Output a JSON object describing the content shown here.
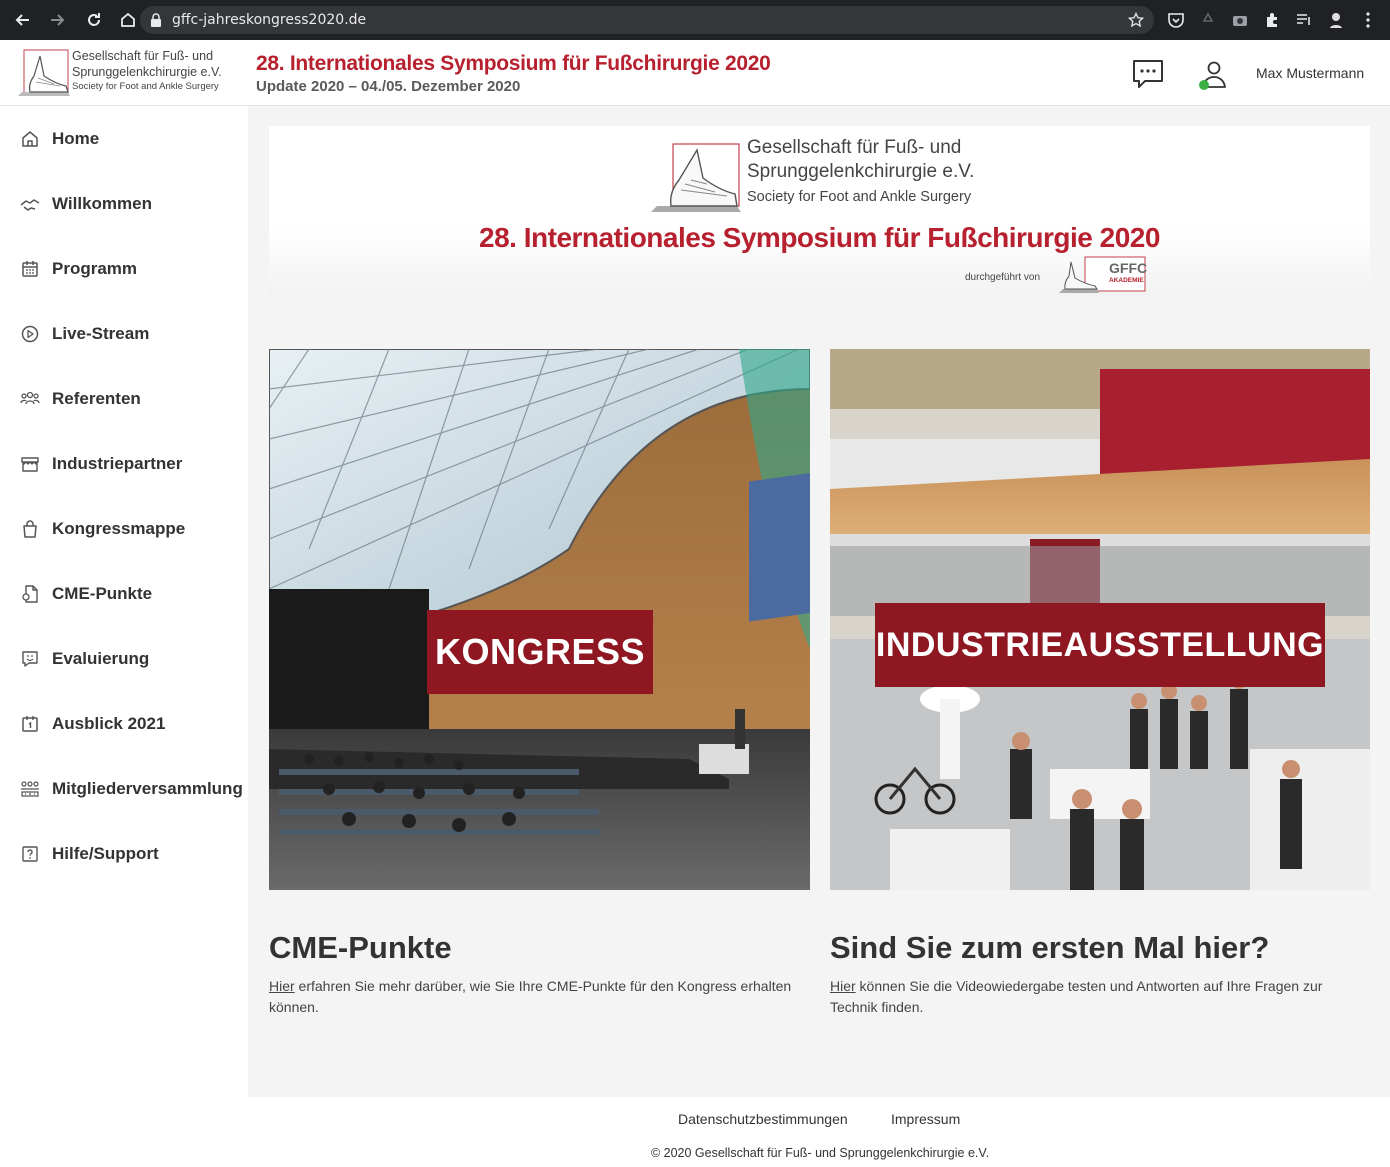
{
  "browser": {
    "url": "gffc-jahreskongress2020.de"
  },
  "header": {
    "logo_line1": "Gesellschaft für Fuß- und",
    "logo_line2": "Sprunggelenkchirurgie e.V.",
    "logo_line3": "Society for Foot and Ankle Surgery",
    "title": "28. Internationales Symposium für Fußchirurgie 2020",
    "subtitle": "Update 2020 – 04./05. Dezember 2020",
    "user_name": "Max Mustermann",
    "online_color": "#3cb043"
  },
  "sidebar": {
    "items": [
      {
        "label": "Home",
        "icon": "home-icon"
      },
      {
        "label": "Willkommen",
        "icon": "handshake-icon"
      },
      {
        "label": "Programm",
        "icon": "calendar-icon"
      },
      {
        "label": "Live-Stream",
        "icon": "play-icon"
      },
      {
        "label": "Referenten",
        "icon": "people-icon"
      },
      {
        "label": "Industriepartner",
        "icon": "store-icon"
      },
      {
        "label": "Kongressmappe",
        "icon": "bag-icon"
      },
      {
        "label": "CME-Punkte",
        "icon": "document-icon"
      },
      {
        "label": "Evaluierung",
        "icon": "feedback-icon"
      },
      {
        "label": "Ausblick 2021",
        "icon": "calendar-one-icon"
      },
      {
        "label": "Mitgliederversammlung",
        "icon": "assembly-icon"
      },
      {
        "label": "Hilfe/Support",
        "icon": "help-icon"
      }
    ]
  },
  "banner": {
    "logo_line1": "Gesellschaft für Fuß- und",
    "logo_line2": "Sprunggelenkchirurgie e.V.",
    "logo_line3": "Society for Foot and Ankle Surgery",
    "title": "28. Internationales Symposium für Fußchirurgie 2020",
    "by": "durchgeführt von",
    "gffc": "GFFC",
    "gffc_sub": "AKADEMIE"
  },
  "tiles": {
    "left_label": "KONGRESS",
    "right_label": "INDUSTRIEAUSSTELLUNG"
  },
  "cards": {
    "cme_title": "CME-Punkte",
    "cme_link": "Hier",
    "cme_text": " erfahren Sie mehr darüber, wie Sie Ihre CME-Punkte für den Kongress erhalten können.",
    "first_title": "Sind Sie zum ersten Mal hier?",
    "first_link": "Hier",
    "first_text": " können Sie die Videowiedergabe testen und Antworten auf Ihre Fragen zur Technik finden."
  },
  "footer": {
    "privacy": "Datenschutzbestimmungen",
    "imprint": "Impressum",
    "copyright": "© 2020 Gesellschaft für Fuß- und Sprunggelenkchirurgie e.V."
  },
  "colors": {
    "brand_red": "#b7202e",
    "label_red": "#8e1722"
  }
}
